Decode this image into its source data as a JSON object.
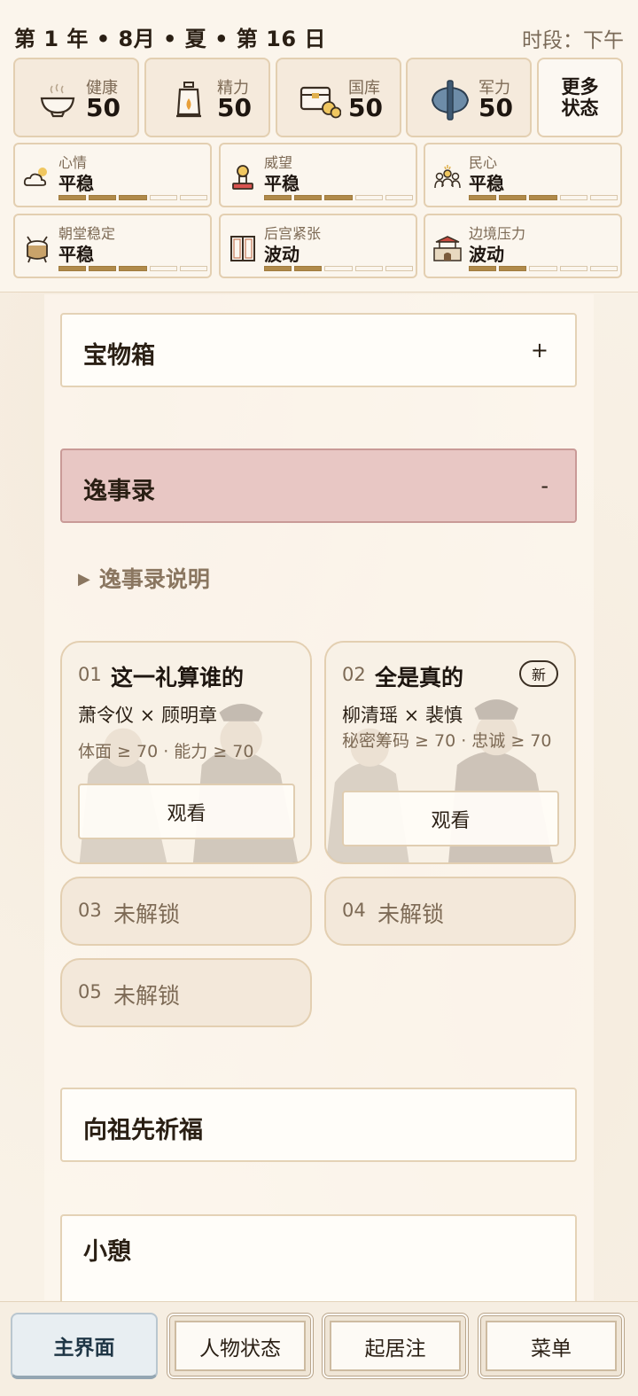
{
  "header": {
    "date": "第 1 年 • 8月 • 夏 • 第 16 日",
    "period": "时段：下午"
  },
  "stats": [
    {
      "label": "健康",
      "value": "50",
      "icon": "bowl-icon"
    },
    {
      "label": "精力",
      "value": "50",
      "icon": "lantern-icon"
    },
    {
      "label": "国库",
      "value": "50",
      "icon": "treasury-chest-icon"
    },
    {
      "label": "军力",
      "value": "50",
      "icon": "axe-icon"
    }
  ],
  "more_status": "更多\n状态",
  "conditions": [
    {
      "label": "心情",
      "value": "平稳",
      "level": 3,
      "max": 5,
      "icon": "weather-icon"
    },
    {
      "label": "威望",
      "value": "平稳",
      "level": 3,
      "max": 5,
      "icon": "seal-icon"
    },
    {
      "label": "民心",
      "value": "平稳",
      "level": 3,
      "max": 5,
      "icon": "people-icon"
    },
    {
      "label": "朝堂稳定",
      "value": "平稳",
      "level": 3,
      "max": 5,
      "icon": "drum-icon"
    },
    {
      "label": "后宫紧张",
      "value": "波动",
      "level": 2,
      "max": 5,
      "icon": "door-icon"
    },
    {
      "label": "边境压力",
      "value": "波动",
      "level": 2,
      "max": 5,
      "icon": "fortress-icon"
    }
  ],
  "sections": {
    "treasure": {
      "title": "宝物箱",
      "toggle": "+"
    },
    "anecdotes": {
      "title": "逸事录",
      "toggle": "-"
    },
    "ancestors": {
      "title": "向祖先祈福"
    },
    "rest": {
      "title": "小憩"
    }
  },
  "explain_label": "逸事录说明",
  "stories": [
    {
      "num": "01",
      "name": "这一礼算谁的",
      "pair": "萧令仪 × 顾明章",
      "req": "体面 ≥ 70 · 能力 ≥ 70",
      "button": "观看"
    },
    {
      "num": "02",
      "name": "全是真的",
      "pair": "柳清瑶 × 裴慎",
      "req": "秘密筹码 ≥ 70 · 忠诚 ≥ 70",
      "button": "观看",
      "tag": "新"
    }
  ],
  "locked": [
    {
      "num": "03",
      "text": "未解锁"
    },
    {
      "num": "04",
      "text": "未解锁"
    },
    {
      "num": "05",
      "text": "未解锁"
    }
  ],
  "nav": [
    "主界面",
    "人物状态",
    "起居注",
    "菜单"
  ]
}
